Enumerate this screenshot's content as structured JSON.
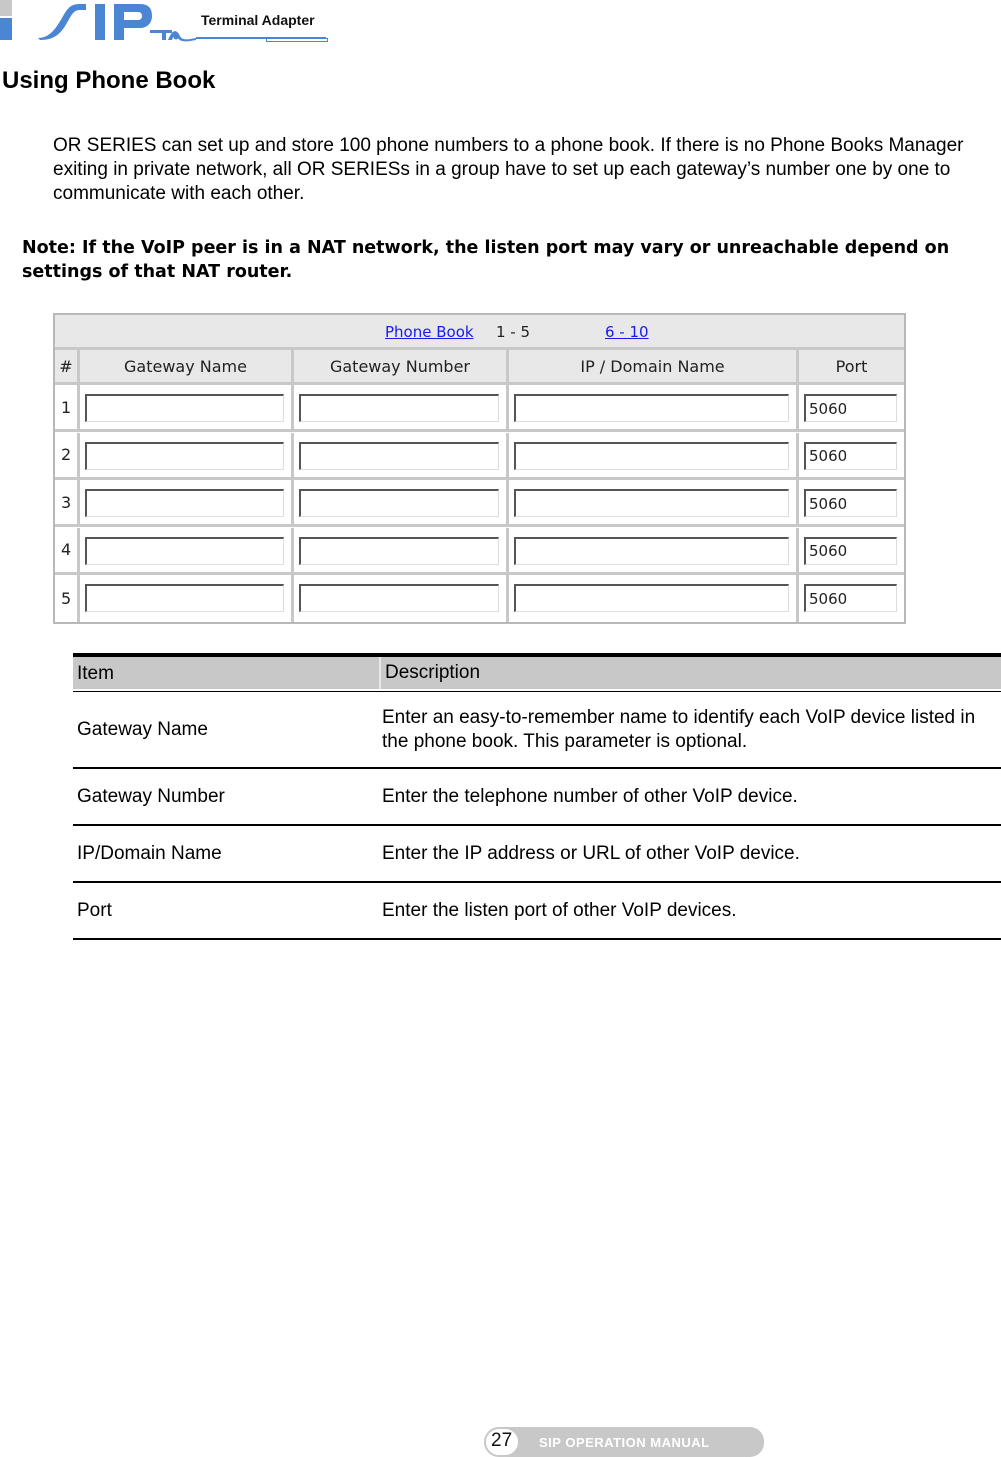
{
  "header": {
    "logo_text": "SIP",
    "logo_subtext": "TA",
    "title": "Terminal Adapter",
    "brand_color": "#4a86d4"
  },
  "section": {
    "title": "Using Phone Book"
  },
  "intro": "OR SERIES can set up and store 100 phone numbers to a phone book. If there is no Phone Books Manager exiting in private network, all OR SERIESs in a group have to set up each gateway’s number one by one to communicate with each other.",
  "note": "Note: If the VoIP peer is in a NAT network, the listen port may vary or unreachable depend on settings of that NAT router.",
  "phonebook": {
    "title_link": "Phone Book",
    "current_range": "1 - 5",
    "next_range_link": "6 - 10",
    "columns": [
      "#",
      "Gateway Name",
      "Gateway Number",
      "IP / Domain Name",
      "Port"
    ],
    "rows": [
      {
        "num": "1",
        "gateway_name": "",
        "gateway_number": "",
        "ip_domain": "",
        "port": "5060"
      },
      {
        "num": "2",
        "gateway_name": "",
        "gateway_number": "",
        "ip_domain": "",
        "port": "5060"
      },
      {
        "num": "3",
        "gateway_name": "",
        "gateway_number": "",
        "ip_domain": "",
        "port": "5060"
      },
      {
        "num": "4",
        "gateway_name": "",
        "gateway_number": "",
        "ip_domain": "",
        "port": "5060"
      },
      {
        "num": "5",
        "gateway_name": "",
        "gateway_number": "",
        "ip_domain": "",
        "port": "5060"
      }
    ]
  },
  "description_table": {
    "headers": [
      "Item",
      "Description"
    ],
    "rows": [
      {
        "item": "Gateway Name",
        "description": "Enter an easy-to-remember name to identify each VoIP device listed in the phone book. This parameter is optional."
      },
      {
        "item": "Gateway Number",
        "description": "Enter the telephone number of other VoIP device."
      },
      {
        "item": "IP/Domain Name",
        "description": "Enter the IP address or URL of other VoIP device."
      },
      {
        "item": "Port",
        "description": "Enter the listen port of other VoIP devices."
      }
    ]
  },
  "footer": {
    "page_number": "27",
    "manual_title": "SIP OPERATION MANUAL"
  }
}
